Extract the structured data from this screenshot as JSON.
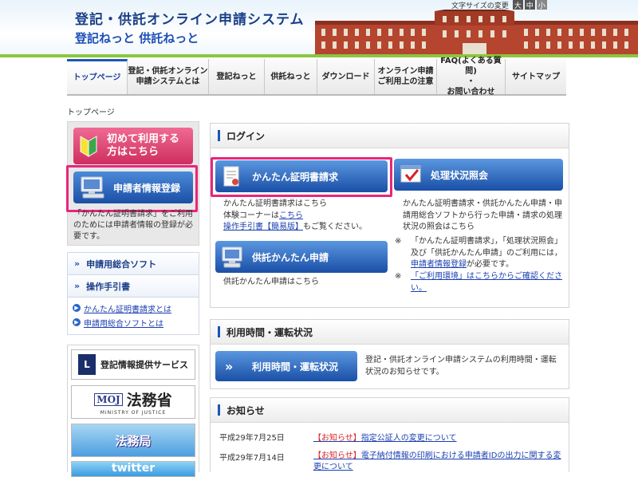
{
  "header": {
    "title": "登記・供託オンライン申請システム",
    "subtitle": "登記ねっと 供託ねっと",
    "font_size_label": "文字サイズの変更",
    "font_sizes": [
      "大",
      "中",
      "小"
    ]
  },
  "nav": {
    "items": [
      {
        "label": "トップページ",
        "active": true
      },
      {
        "label": "登記・供託オンライン\n申請システムとは"
      },
      {
        "label": "登記ねっと"
      },
      {
        "label": "供託ねっと"
      },
      {
        "label": "ダウンロード"
      },
      {
        "label": "オンライン申請\nご利用上の注意"
      },
      {
        "label": "FAQ(よくある質問)\n・\nお問い合わせ"
      },
      {
        "label": "サイトマップ"
      }
    ]
  },
  "breadcrumb": "トップページ",
  "left": {
    "first_time_label": "初めて利用する\n方はこちら",
    "register_label": "申請者情報登録",
    "register_note": "「かんたん証明書請求」をご利用のためには申請者情報の登録が必要です。",
    "menu": {
      "items": [
        "申請用総合ソフト",
        "操作手引書"
      ],
      "links": [
        "かんたん証明書請求とは",
        "申請用総合ソフトとは"
      ]
    },
    "banners": {
      "touki": "登記情報提供サービス",
      "moj_mark": "MOJ",
      "moj": "法務省",
      "moj_en": "MINISTRY OF JUSTICE",
      "houmukyoku": "法務局",
      "twitter": "twitter"
    }
  },
  "login": {
    "title": "ログイン",
    "kantan_label": "かんたん証明書請求",
    "kantan_text": "かんたん証明書請求はこちら",
    "trial_prefix": "体験コーナーは",
    "trial_link": "こちら",
    "manual_link": "操作手引書【簡易版】",
    "manual_suffix": "もご覧ください。",
    "kyotaku_label": "供託かんたん申請",
    "kyotaku_text": "供託かんたん申請はこちら",
    "status_label": "処理状況照会",
    "status_text": "かんたん証明書請求・供託かんたん申請・申請用総合ソフトから行った申請・請求の処理状況の照会はこちら",
    "note1_mark": "※",
    "note1_a": "「かんたん証明書請求」，「処理状況照会」及び「供託かんたん申請」のご利用には，",
    "note1_link": "申請者情報登録",
    "note1_b": "が必要です。",
    "note2_mark": "※",
    "note2_link": "「ご利用環境」はこちらからご確認ください。"
  },
  "hours": {
    "title": "利用時間・運転状況",
    "button_label": "利用時間・運転状況",
    "text": "登記・供託オンライン申請システムの利用時間・運転状況のお知らせです。"
  },
  "news": {
    "title": "お知らせ",
    "items": [
      {
        "date": "平成29年7月25日",
        "tag": "【お知らせ】",
        "title": "指定公証人の変更について"
      },
      {
        "date": "平成29年7月14日",
        "tag": "【お知らせ】",
        "title": "電子納付情報の印刷における申請者IDの出力に関する変更について"
      }
    ]
  },
  "colors": {
    "accent": "#1a56b8",
    "highlight": "#e8267a",
    "nav_green": "#8cc63f"
  }
}
